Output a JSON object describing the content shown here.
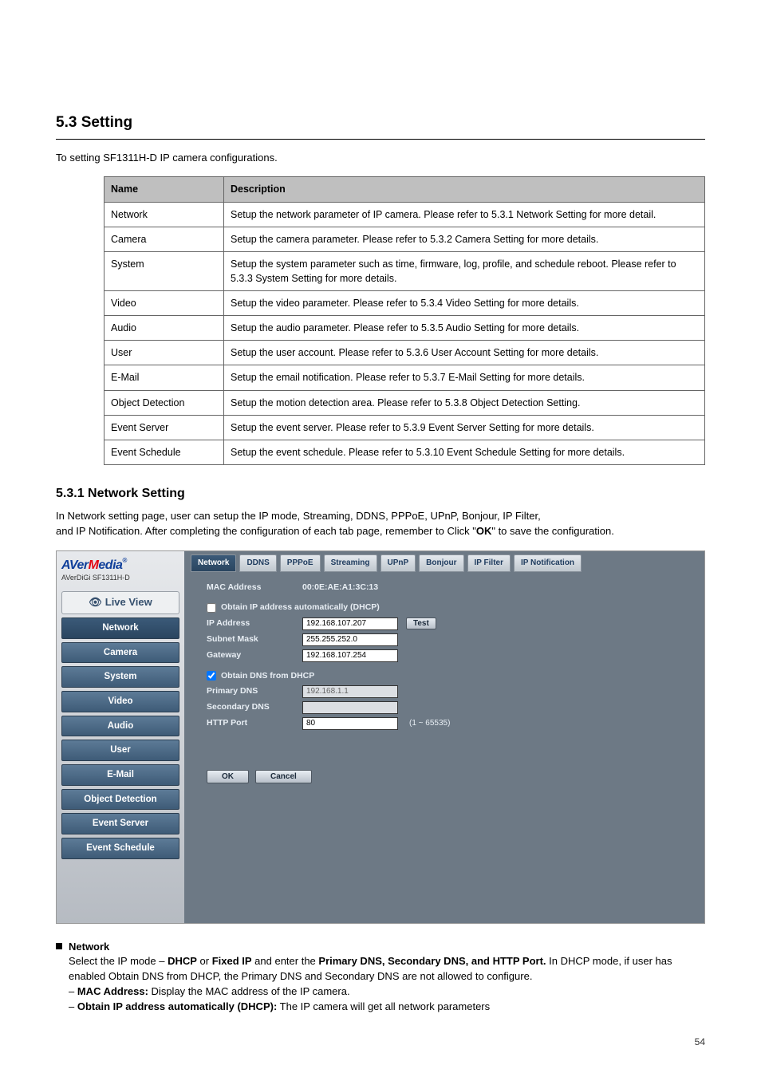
{
  "section_heading": "5.3 Setting",
  "setting_intro": "To setting SF1311H-D IP camera configurations.",
  "table": {
    "head_name": "Name",
    "head_desc": "Description",
    "rows": [
      {
        "name": "Network",
        "desc": "Setup the network parameter of IP camera. Please refer to 5.3.1 Network Setting for more detail."
      },
      {
        "name": "Camera",
        "desc": "Setup the camera parameter. Please refer to 5.3.2 Camera Setting for more details."
      },
      {
        "name": "System",
        "desc": "Setup the system parameter such as time, firmware, log, profile, and schedule reboot. Please refer to 5.3.3 System Setting for more details."
      },
      {
        "name": "Video",
        "desc": "Setup the video parameter. Please refer to 5.3.4 Video Setting for more details."
      },
      {
        "name": "Audio",
        "desc": "Setup the audio parameter. Please refer to 5.3.5 Audio Setting for more details."
      },
      {
        "name": "User",
        "desc": "Setup the user account. Please refer to 5.3.6 User Account Setting for more details."
      },
      {
        "name": "E-Mail",
        "desc": "Setup the email notification. Please refer to 5.3.7 E-Mail Setting for more details."
      },
      {
        "name": "Object Detection",
        "desc": "Setup the motion detection area. Please refer to 5.3.8 Object Detection Setting."
      },
      {
        "name": "Event Server",
        "desc": "Setup the event server. Please refer to 5.3.9 Event Server Setting for more details."
      },
      {
        "name": "Event Schedule",
        "desc": "Setup the event schedule. Please refer to 5.3.10 Event Schedule Setting for more details."
      }
    ]
  },
  "subsec_heading": "5.3.1 Network Setting",
  "network_intro_line1": "In Network setting page, user can setup the IP mode, Streaming, DDNS, PPPoE, UPnP, Bonjour, IP Filter,",
  "network_intro_line2_a": "and IP Notification. After completing the configuration of each tab page, remember to Click \"",
  "network_intro_ok": "OK",
  "network_intro_line2_b": "\" to save the configuration.",
  "screenshot": {
    "logo_brand": "AVerMedia",
    "logo_sub": "AVerDiGi SF1311H-D",
    "live_label": "Live View",
    "nav": [
      "Network",
      "Camera",
      "System",
      "Video",
      "Audio",
      "User",
      "E-Mail",
      "Object Detection",
      "Event Server",
      "Event Schedule"
    ],
    "nav_active_index": 0,
    "tabs": [
      "Network",
      "DDNS",
      "PPPoE",
      "Streaming",
      "UPnP",
      "Bonjour",
      "IP Filter",
      "IP Notification"
    ],
    "tab_active_index": 0,
    "mac_label": "MAC Address",
    "mac_value": "00:0E:AE:A1:3C:13",
    "dhcp_label": "Obtain IP address automatically (DHCP)",
    "ip_label": "IP Address",
    "ip_value": "192.168.107.207",
    "test_label": "Test",
    "mask_label": "Subnet Mask",
    "mask_value": "255.255.252.0",
    "gw_label": "Gateway",
    "gw_value": "192.168.107.254",
    "dns_dhcp_label": "Obtain DNS from DHCP",
    "pdns_label": "Primary DNS",
    "pdns_value": "192.168.1.1",
    "sdns_label": "Secondary DNS",
    "sdns_value": "",
    "http_label": "HTTP Port",
    "http_value": "80",
    "http_range": "(1 ~ 65535)",
    "ok": "OK",
    "cancel": "Cancel"
  },
  "bullet_heading": "Network",
  "bullet_body_1": "Select the IP mode –",
  "bullet_body_dhcp": " DHCP",
  "bullet_body_2": " or",
  "bullet_body_fixed": " Fixed IP",
  "bullet_body_3": " and enter the",
  "bullet_body_bold_tail": " Primary DNS, Secondary DNS, and HTTP Port.",
  "bullet_body_4": " In DHCP mode, if user has enabled Obtain DNS from DHCP, the Primary DNS and Secondary DNS are not allowed to configure.",
  "bullet_dash_1_a": "–",
  "bullet_dash_1_mac": " MAC Address:",
  "bullet_dash_1_b": " Display the MAC address of the IP camera.",
  "bullet_dash_2_a": "–",
  "bullet_dash_2_dhcp": " Obtain IP address automatically (DHCP):",
  "bullet_dash_2_b": " The IP camera will get all network parameters",
  "page_number": "54"
}
